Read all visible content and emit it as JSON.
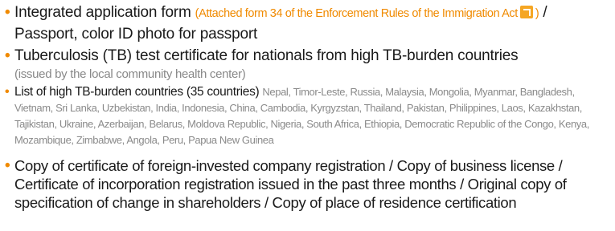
{
  "items": [
    {
      "text": "Integrated application form",
      "ref": "(Attached form 34 of the Enforcement Rules of the Immigration Act",
      "ref_close": ")",
      "rest": " / Passport, color ID photo for passport"
    },
    {
      "text": "Tuberculosis (TB) test certificate for nationals from high TB-burden countries",
      "note": "(issued by the local community health center)"
    },
    {
      "title": "List of high TB-burden countries (35 countries)",
      "countries": "Nepal, Timor-Leste, Russia, Malaysia, Mongolia, Myanmar, Bangladesh, Vietnam, Sri Lanka, Uzbekistan, India, Indonesia, China, Cambodia, Kyrgyzstan, Thailand, Pakistan, Philippines, Laos, Kazakhstan, Tajikistan, Ukraine, Azerbaijan, Belarus, Moldova Republic, Nigeria, South Africa, Ethiopia, Democratic Republic of the Congo, Kenya, Mozambique, Zimbabwe, Angola, Peru, Papua New Guinea"
    },
    {
      "text": "Copy of certificate of foreign-invested company registration / Copy of business license / Certificate of incorporation registration issued in the past three months / Original copy of specification of change in shareholders / Copy of place of residence certification"
    }
  ],
  "icons": {
    "link": "external-link-icon"
  },
  "colors": {
    "bullet": "#f08a00",
    "reference": "#f08a00",
    "muted": "#888888"
  }
}
